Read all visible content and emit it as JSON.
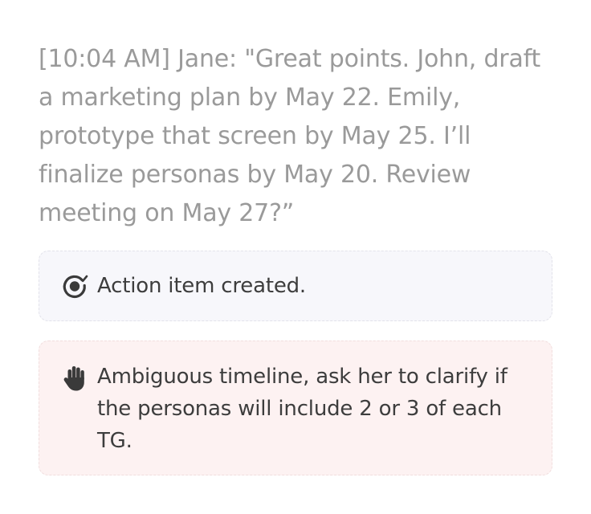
{
  "transcript": {
    "text": "[10:04 AM] Jane: \"Great points. John, draft a marketing plan by May 22. Emily, prototype that screen by May 25. I’ll finalize personas by May 20. Review meeting on May 27?”"
  },
  "action_card": {
    "icon": "target-check-icon",
    "label": "Action item created."
  },
  "warning_card": {
    "icon": "raised-hand-icon",
    "label": "Ambiguous timeline, ask her to clarify if the personas will include 2 or 3 of each TG."
  },
  "colors": {
    "transcript_text": "#9a9a9a",
    "action_bg": "#f7f7fb",
    "warning_bg": "#fdf2f2",
    "icon": "#3a3a3a"
  }
}
